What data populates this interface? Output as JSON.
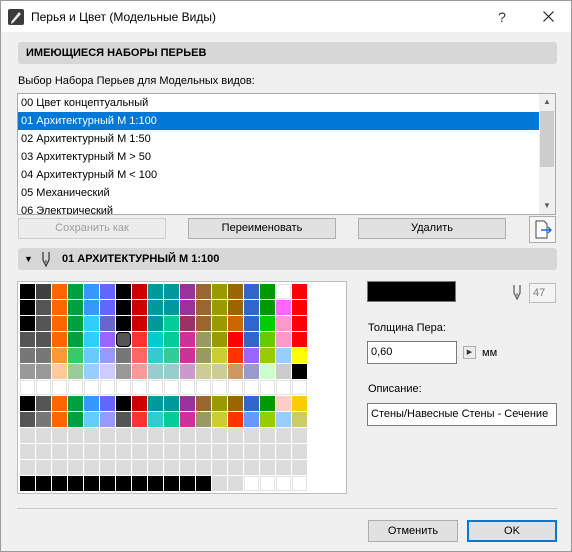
{
  "window": {
    "title": "Перья и Цвет (Модельные Виды)",
    "help_label": "?"
  },
  "section": {
    "title": "ИМЕЮЩИЕСЯ НАБОРЫ ПЕРЬЕВ",
    "list_caption": "Выбор Набора Перьев для Модельных видов:"
  },
  "pen_sets": [
    {
      "label": "00 Цвет концептуальный"
    },
    {
      "label": "01 Архитектурный М 1:100"
    },
    {
      "label": "02 Архитектурный М 1:50"
    },
    {
      "label": "03 Архитектурный М > 50"
    },
    {
      "label": "04 Архитектурный М < 100"
    },
    {
      "label": "05 Механический"
    },
    {
      "label": "06 Электрический"
    }
  ],
  "selected_pen_set_index": 1,
  "buttons": {
    "save_as": "Сохранить как",
    "rename": "Переименовать",
    "delete": "Удалить",
    "cancel": "Отменить",
    "ok": "OK"
  },
  "pen_set_detail": {
    "title": "01 АРХИТЕКТУРНЫЙ М 1:100",
    "pen_number": "47",
    "selected_color": "#000000",
    "pen_weight_label": "Толщина Пера:",
    "pen_weight_value": "0,60",
    "pen_weight_unit": "мм",
    "description_label": "Описание:",
    "description_value": "Стены/Навесные Стены - Сечение"
  },
  "palette": {
    "rows": [
      [
        "#000000",
        "#404040",
        "#ff6600",
        "#00a040",
        "#3399ff",
        "#6666ff",
        "#000000",
        "#cc0000",
        "#009999",
        "#009999",
        "#993399",
        "#996633",
        "#999900",
        "#996600",
        "#3366cc",
        "#009900",
        "#ffffff",
        "#ff0000"
      ],
      [
        "#000000",
        "#555555",
        "#ff6600",
        "#00a040",
        "#3399ff",
        "#6666ff",
        "#000000",
        "#cc0000",
        "#009999",
        "#009999",
        "#993399",
        "#996633",
        "#999900",
        "#996600",
        "#3366cc",
        "#009900",
        "#ff66ff",
        "#ff0000"
      ],
      [
        "#000000",
        "#555555",
        "#ff6600",
        "#00a040",
        "#33ccff",
        "#6666cc",
        "#000000",
        "#cc0000",
        "#009999",
        "#00cc99",
        "#993366",
        "#996633",
        "#999900",
        "#cc6600",
        "#3366cc",
        "#00cc00",
        "#ff99cc",
        "#ff0000"
      ],
      [
        "#555555",
        "#555555",
        "#ff6600",
        "#00a040",
        "#33ccff",
        "#9966ff",
        "#555555",
        "#ff3333",
        "#00cccc",
        "#00cc99",
        "#cc3399",
        "#999966",
        "#999900",
        "#ff0000",
        "#3366cc",
        "#66cc00",
        "#ff99cc",
        "#ff0000"
      ],
      [
        "#777777",
        "#777777",
        "#ff9933",
        "#33cc66",
        "#66ccff",
        "#9999ff",
        "#777777",
        "#ff6666",
        "#33cccc",
        "#33cc99",
        "#cc3399",
        "#999966",
        "#cccc33",
        "#ff3300",
        "#9966ff",
        "#99cc00",
        "#99ccff",
        "#ffff00"
      ],
      [
        "#999999",
        "#999999",
        "#ffcc99",
        "#99cc99",
        "#99ccff",
        "#ccccff",
        "#999999",
        "#ff9999",
        "#99cccc",
        "#99cccc",
        "#cc99cc",
        "#cccc99",
        "#cccc99",
        "#cc9966",
        "#9999cc",
        "#ccffcc",
        "#cccccc",
        "#000000"
      ],
      [
        "#ffffff",
        "#ffffff",
        "#ffffff",
        "#ffffff",
        "#ffffff",
        "#ffffff",
        "#ffffff",
        "#ffffff",
        "#ffffff",
        "#ffffff",
        "#ffffff",
        "#ffffff",
        "#ffffff",
        "#ffffff",
        "#ffffff",
        "#ffffff",
        "#ffffff",
        "#ffffff"
      ],
      [
        "#000000",
        "#555555",
        "#ff6600",
        "#00a040",
        "#3399ff",
        "#6666ff",
        "#000000",
        "#cc0000",
        "#009999",
        "#009999",
        "#993399",
        "#996633",
        "#999900",
        "#996600",
        "#3366cc",
        "#009900",
        "#ffcccc",
        "#ffcc00"
      ],
      [
        "#555555",
        "#777777",
        "#ff6600",
        "#00a040",
        "#66ccff",
        "#9999ff",
        "#555555",
        "#ff3333",
        "#33cccc",
        "#00cc99",
        "#cc3399",
        "#999966",
        "#cccc33",
        "#ff3300",
        "#6699ff",
        "#99cc00",
        "#99ccff",
        "#cccc66"
      ],
      [
        "#dcdcdc",
        "#dcdcdc",
        "#dcdcdc",
        "#dcdcdc",
        "#dcdcdc",
        "#dcdcdc",
        "#dcdcdc",
        "#dcdcdc",
        "#dcdcdc",
        "#dcdcdc",
        "#dcdcdc",
        "#dcdcdc",
        "#dcdcdc",
        "#dcdcdc",
        "#dcdcdc",
        "#dcdcdc",
        "#dcdcdc",
        "#dcdcdc"
      ],
      [
        "#dcdcdc",
        "#dcdcdc",
        "#dcdcdc",
        "#dcdcdc",
        "#dcdcdc",
        "#dcdcdc",
        "#dcdcdc",
        "#dcdcdc",
        "#dcdcdc",
        "#dcdcdc",
        "#dcdcdc",
        "#dcdcdc",
        "#dcdcdc",
        "#dcdcdc",
        "#dcdcdc",
        "#dcdcdc",
        "#dcdcdc",
        "#dcdcdc"
      ],
      [
        "#dcdcdc",
        "#dcdcdc",
        "#dcdcdc",
        "#dcdcdc",
        "#dcdcdc",
        "#dcdcdc",
        "#dcdcdc",
        "#dcdcdc",
        "#dcdcdc",
        "#dcdcdc",
        "#dcdcdc",
        "#dcdcdc",
        "#dcdcdc",
        "#dcdcdc",
        "#dcdcdc",
        "#dcdcdc",
        "#dcdcdc",
        "#dcdcdc"
      ],
      [
        "#000000",
        "#000000",
        "#000000",
        "#000000",
        "#000000",
        "#000000",
        "#000000",
        "#000000",
        "#000000",
        "#000000",
        "#000000",
        "#000000",
        "#dcdcdc",
        "#dcdcdc",
        "#ffffff",
        "#ffffff",
        "#ffffff",
        "#ffffff"
      ]
    ],
    "selected_cell": [
      3,
      6
    ]
  },
  "icons": {
    "app": "archicad-icon",
    "close": "close-icon",
    "pen": "pen-icon",
    "export": "export-icon",
    "collapse": "triangle-down-icon",
    "spin": "arrow-right-icon"
  }
}
